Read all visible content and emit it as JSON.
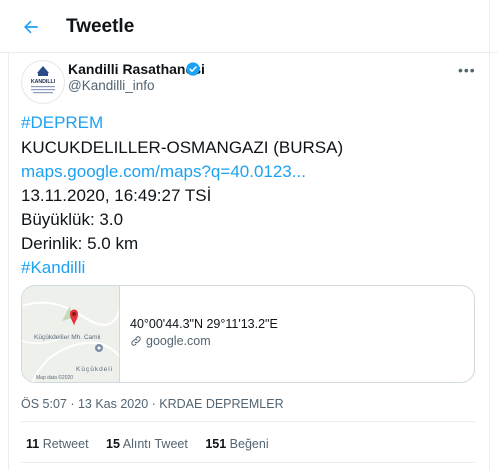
{
  "header": {
    "title": "Tweetle",
    "back_icon": "arrow-left-icon"
  },
  "author": {
    "name": "Kandilli Rasathanesi",
    "handle": "@Kandilli_info",
    "avatar_text": "KANDILLI",
    "verified_color": "#1da1f2"
  },
  "tweet": {
    "hashtag1": "#DEPREM",
    "location": "KUCUKDELILLER-OSMANGAZI (BURSA)",
    "link": "maps.google.com/maps?q=40.0123...",
    "datetime": "13.11.2020, 16:49:27 TSİ",
    "magnitude": "Büyüklük: 3.0",
    "depth": "Derinlik: 5.0 km",
    "hashtag2": "#Kandilli"
  },
  "card": {
    "coordinates": "40°00'44.3\"N 29°11'13.2\"E",
    "domain": "google.com",
    "map_label1": "Küçükdeliler Mh. Camii",
    "map_label2": "Küçükdeli",
    "map_copyright": "Map data ©2020"
  },
  "meta": {
    "text": "ÖS 5:07 · 13 Kas 2020 · KRDAE DEPREMLER"
  },
  "stats": {
    "retweets_count": "11",
    "retweets_label": "Retweet",
    "quotes_count": "15",
    "quotes_label": "Alıntı Tweet",
    "likes_count": "151",
    "likes_label": "Beğeni"
  },
  "colors": {
    "accent": "#1da1f2",
    "secondary_text": "#536471",
    "pin": "#e5333b"
  }
}
